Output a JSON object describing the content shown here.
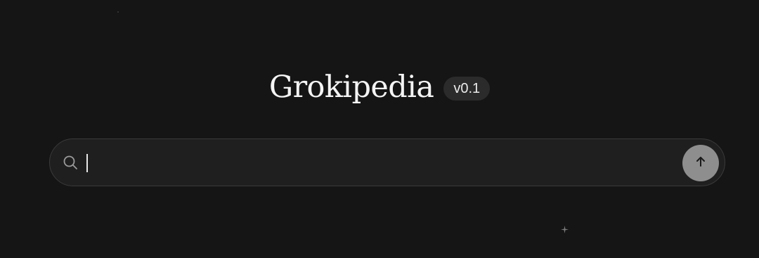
{
  "header": {
    "title": "Grokipedia",
    "version_badge": "v0.1"
  },
  "search": {
    "value": "",
    "placeholder": "",
    "icon": "search-icon",
    "submit_icon": "arrow-up-icon"
  },
  "colors": {
    "background": "#151515",
    "search_bg": "#1f1f1f",
    "search_border": "#3a3a3a",
    "badge_bg": "#2b2b2b",
    "submit_bg": "#8e8e8e"
  }
}
